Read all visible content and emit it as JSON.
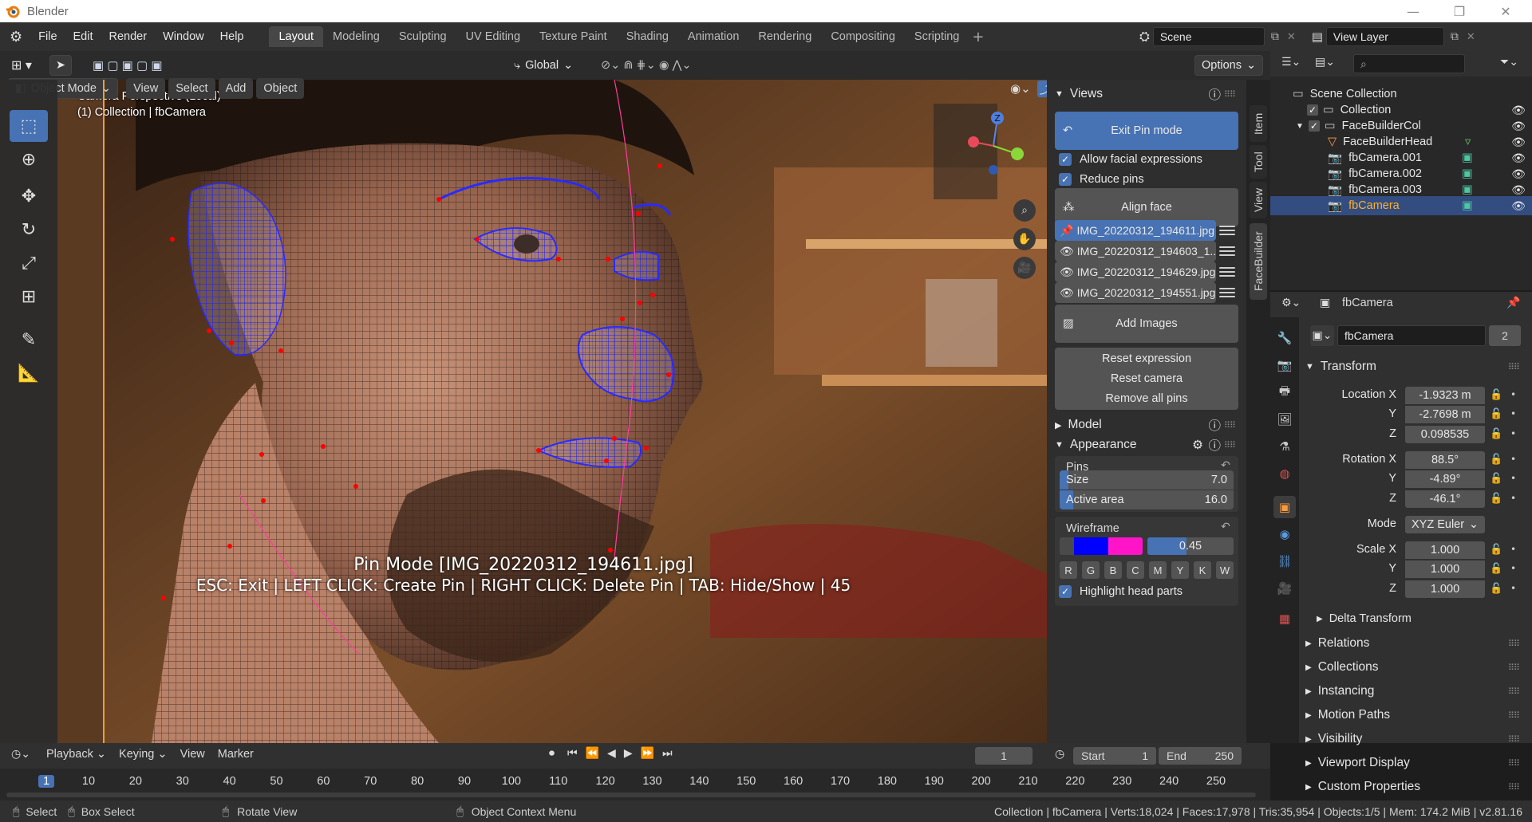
{
  "window": {
    "title": "Blender"
  },
  "menu": [
    "File",
    "Edit",
    "Render",
    "Window",
    "Help"
  ],
  "workspaces": [
    "Layout",
    "Modeling",
    "Sculpting",
    "UV Editing",
    "Texture Paint",
    "Shading",
    "Animation",
    "Rendering",
    "Compositing",
    "Scripting"
  ],
  "scene": {
    "label": "Scene",
    "view_layer": "View Layer"
  },
  "viewport_header": {
    "mode": "Object Mode",
    "menus": [
      "View",
      "Select",
      "Add",
      "Object"
    ],
    "orientation": "Global",
    "options": "Options"
  },
  "viewport": {
    "info_line1": "Camera Perspective (Local)",
    "info_line2": "(1) Collection | fbCamera",
    "overlay_title": "Pin Mode  [IMG_20220312_194611.jpg]",
    "overlay_help": "ESC: Exit | LEFT CLICK: Create Pin | RIGHT CLICK: Delete Pin | TAB: Hide/Show | 45",
    "gizmo_axis": "Z"
  },
  "npanel": {
    "tabs": [
      "Item",
      "Tool",
      "View",
      "FaceBuilder"
    ],
    "views_title": "Views",
    "exit_pin_mode": "Exit Pin mode",
    "allow_facial": "Allow facial expressions",
    "reduce_pins": "Reduce pins",
    "align_face": "Align face",
    "images": [
      "IMG_20220312_194611.jpg",
      "IMG_20220312_194603_1...",
      "IMG_20220312_194629.jpg",
      "IMG_20220312_194551.jpg"
    ],
    "add_images": "Add Images",
    "reset_expression": "Reset expression",
    "reset_camera": "Reset camera",
    "remove_all_pins": "Remove all pins",
    "model_title": "Model",
    "appearance_title": "Appearance",
    "pins_label": "Pins",
    "size_label": "Size",
    "size_value": "7.0",
    "size_fraction": 0.05,
    "active_area_label": "Active area",
    "active_area_value": "16.0",
    "active_area_fraction": 0.08,
    "wireframe_label": "Wireframe",
    "wire_color1": "#0000ff",
    "wire_color2": "#ff14c8",
    "wire_opacity": "0.45",
    "wire_opacity_fraction": 0.45,
    "letters": [
      "R",
      "G",
      "B",
      "C",
      "M",
      "Y",
      "K",
      "W"
    ],
    "highlight_head": "Highlight head parts"
  },
  "outliner": {
    "root": "Scene Collection",
    "items": [
      {
        "name": "Collection",
        "level": 1,
        "icon": "collection-icon"
      },
      {
        "name": "FaceBuilderCol",
        "level": 1,
        "icon": "collection-icon"
      },
      {
        "name": "FaceBuilderHead",
        "level": 2,
        "icon": "mesh-icon"
      },
      {
        "name": "fbCamera.001",
        "level": 2,
        "icon": "camera-icon"
      },
      {
        "name": "fbCamera.002",
        "level": 2,
        "icon": "camera-icon"
      },
      {
        "name": "fbCamera.003",
        "level": 2,
        "icon": "camera-icon"
      },
      {
        "name": "fbCamera",
        "level": 2,
        "icon": "camera-icon",
        "active": true
      }
    ]
  },
  "properties": {
    "header_object": "fbCamera",
    "datablock": "fbCamera",
    "users": "2",
    "transform_title": "Transform",
    "location_label": "Location X",
    "location": [
      "-1.9323 m",
      "-2.7698 m",
      "0.098535"
    ],
    "rotation_label": "Rotation X",
    "rotation": [
      "88.5°",
      "-4.89°",
      "-46.1°"
    ],
    "mode_label": "Mode",
    "mode_value": "XYZ Euler",
    "scale_label": "Scale X",
    "scale": [
      "1.000",
      "1.000",
      "1.000"
    ],
    "axis_y": "Y",
    "axis_z": "Z",
    "delta_transform": "Delta Transform",
    "sections": [
      "Relations",
      "Collections",
      "Instancing",
      "Motion Paths",
      "Visibility",
      "Viewport Display",
      "Custom Properties"
    ]
  },
  "timeline": {
    "menus": [
      "Playback",
      "Keying",
      "View",
      "Marker"
    ],
    "current_frame": "1",
    "start_label": "Start",
    "start": "1",
    "end_label": "End",
    "end": "250",
    "ticks": [
      "1",
      "10",
      "20",
      "30",
      "40",
      "50",
      "60",
      "70",
      "80",
      "90",
      "100",
      "110",
      "120",
      "130",
      "140",
      "150",
      "160",
      "170",
      "180",
      "190",
      "200",
      "210",
      "220",
      "230",
      "240",
      "250"
    ]
  },
  "statusbar": {
    "select": "Select",
    "box_select": "Box Select",
    "rotate_view": "Rotate View",
    "context_menu": "Object Context Menu",
    "stats": "Collection | fbCamera | Verts:18,024 | Faces:17,978 | Tris:35,954 | Objects:1/5 | Mem: 174.2 MiB | v2.81.16"
  },
  "colors": {
    "accent": "#4772b3",
    "active_object": "#ffaf29",
    "pin": "#ff0000",
    "mesh_wire": "#1a1aff"
  }
}
